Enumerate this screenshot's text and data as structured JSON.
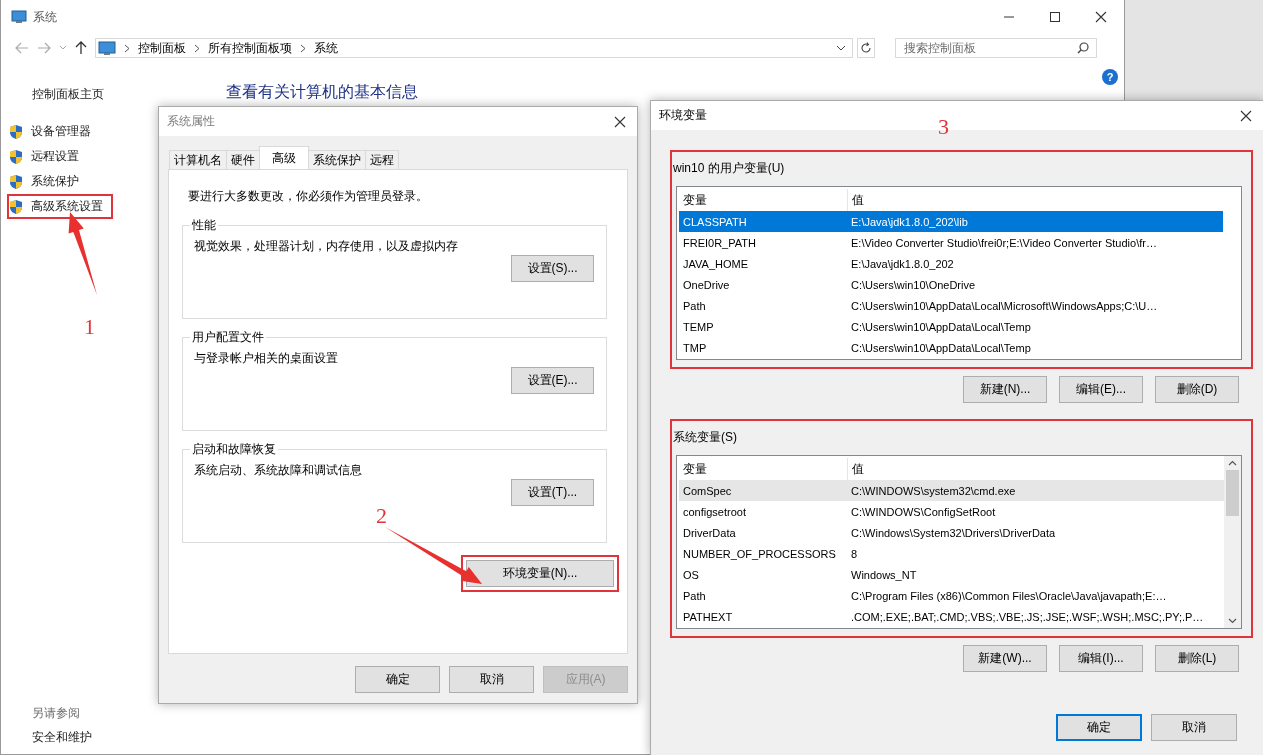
{
  "main_window": {
    "title": "系统",
    "breadcrumb": [
      "控制面板",
      "所有控制面板项",
      "系统"
    ],
    "search": {
      "placeholder": "搜索控制面板"
    },
    "help": "?",
    "sidebar": {
      "home": "控制面板主页",
      "links": [
        {
          "label": "设备管理器",
          "highlighted": false
        },
        {
          "label": "远程设置",
          "highlighted": false
        },
        {
          "label": "系统保护",
          "highlighted": false
        },
        {
          "label": "高级系统设置",
          "highlighted": true
        }
      ],
      "see_also": "另请参阅",
      "see_also_links": [
        "安全和维护"
      ]
    },
    "heading": "查看有关计算机的基本信息"
  },
  "system_properties": {
    "title": "系统属性",
    "tabs": [
      {
        "label": "计算机名",
        "selected": false
      },
      {
        "label": "硬件",
        "selected": false
      },
      {
        "label": "高级",
        "selected": true
      },
      {
        "label": "系统保护",
        "selected": false
      },
      {
        "label": "远程",
        "selected": false
      }
    ],
    "notice": "要进行大多数更改，你必须作为管理员登录。",
    "groups": [
      {
        "title": "性能",
        "description": "视觉效果，处理器计划，内存使用，以及虚拟内存",
        "button": "设置(S)..."
      },
      {
        "title": "用户配置文件",
        "description": "与登录帐户相关的桌面设置",
        "button": "设置(E)..."
      },
      {
        "title": "启动和故障恢复",
        "description": "系统启动、系统故障和调试信息",
        "button": "设置(T)..."
      }
    ],
    "env_button": {
      "label": "环境变量(N)...",
      "highlighted": true
    },
    "buttons": [
      {
        "label": "确定",
        "disabled": false
      },
      {
        "label": "取消",
        "disabled": false
      },
      {
        "label": "应用(A)",
        "disabled": true
      }
    ]
  },
  "environment_variables": {
    "title": "环境变量",
    "lists": [
      {
        "title": "win10 的用户变量(U)",
        "highlighted": true,
        "focused": true,
        "scrollbar": false,
        "columns": [
          "变量",
          "值"
        ],
        "rows": [
          {
            "name": "CLASSPATH",
            "value": "E:\\Java\\jdk1.8.0_202\\lib",
            "selected": true
          },
          {
            "name": "FREI0R_PATH",
            "value": "E:\\Video Converter Studio\\frei0r;E:\\Video Converter Studio\\fr…",
            "selected": false
          },
          {
            "name": "JAVA_HOME",
            "value": "E:\\Java\\jdk1.8.0_202",
            "selected": false
          },
          {
            "name": "OneDrive",
            "value": "C:\\Users\\win10\\OneDrive",
            "selected": false
          },
          {
            "name": "Path",
            "value": "C:\\Users\\win10\\AppData\\Local\\Microsoft\\WindowsApps;C:\\U…",
            "selected": false
          },
          {
            "name": "TEMP",
            "value": "C:\\Users\\win10\\AppData\\Local\\Temp",
            "selected": false
          },
          {
            "name": "TMP",
            "value": "C:\\Users\\win10\\AppData\\Local\\Temp",
            "selected": false
          }
        ],
        "buttons": [
          "新建(N)...",
          "编辑(E)...",
          "删除(D)"
        ]
      },
      {
        "title": "系统变量(S)",
        "highlighted": true,
        "focused": false,
        "scrollbar": true,
        "columns": [
          "变量",
          "值"
        ],
        "rows": [
          {
            "name": "ComSpec",
            "value": "C:\\WINDOWS\\system32\\cmd.exe",
            "selected": true
          },
          {
            "name": "configsetroot",
            "value": "C:\\WINDOWS\\ConfigSetRoot",
            "selected": false
          },
          {
            "name": "DriverData",
            "value": "C:\\Windows\\System32\\Drivers\\DriverData",
            "selected": false
          },
          {
            "name": "NUMBER_OF_PROCESSORS",
            "value": "8",
            "selected": false
          },
          {
            "name": "OS",
            "value": "Windows_NT",
            "selected": false
          },
          {
            "name": "Path",
            "value": "C:\\Program Files (x86)\\Common Files\\Oracle\\Java\\javapath;E:…",
            "selected": false
          },
          {
            "name": "PATHEXT",
            "value": ".COM;.EXE;.BAT;.CMD;.VBS;.VBE;.JS;.JSE;.WSF;.WSH;.MSC;.PY;.P…",
            "selected": false
          }
        ],
        "buttons": [
          "新建(W)...",
          "编辑(I)...",
          "删除(L)"
        ]
      }
    ],
    "buttons": [
      {
        "label": "确定",
        "default": true
      },
      {
        "label": "取消",
        "default": false
      }
    ]
  },
  "annotations": [
    {
      "label": "1",
      "kind": "arrow"
    },
    {
      "label": "2",
      "kind": "arrow"
    },
    {
      "label": "3",
      "kind": "plain"
    }
  ]
}
